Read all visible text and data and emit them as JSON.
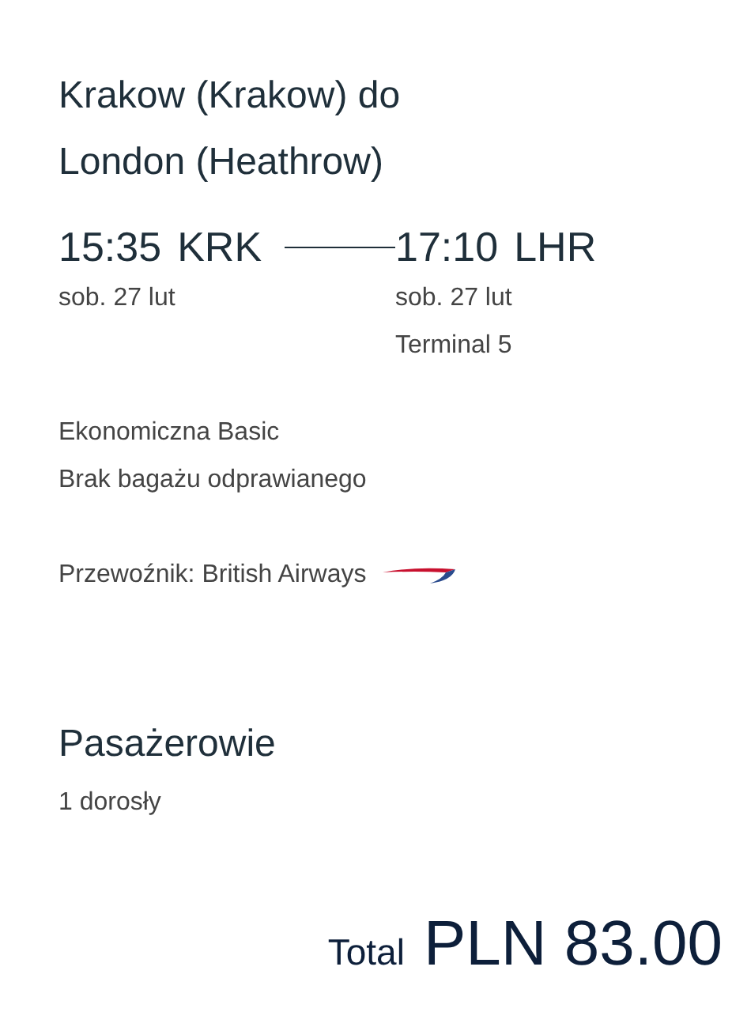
{
  "title": "Krakow (Krakow) do London (Heathrow)",
  "departure": {
    "time": "15:35",
    "code": "KRK",
    "date": "sob. 27 lut"
  },
  "arrival": {
    "time": "17:10",
    "code": "LHR",
    "date": "sob. 27 lut",
    "terminal": "Terminal 5"
  },
  "fare": [
    "Ekonomiczna Basic",
    "Brak bagażu odprawianego"
  ],
  "carrier": "Przewoźnik: British Airways",
  "passengers": {
    "heading": "Pasażerowie",
    "count": "1 dorosły"
  },
  "total": {
    "label": "Total",
    "amount": "PLN 83.00"
  }
}
